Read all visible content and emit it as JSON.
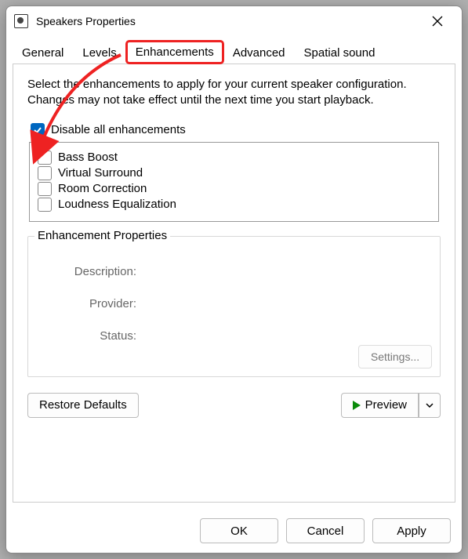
{
  "window": {
    "title": "Speakers Properties"
  },
  "tabs": {
    "general": "General",
    "levels": "Levels",
    "enhancements": "Enhancements",
    "advanced": "Advanced",
    "spatial": "Spatial sound",
    "active": "enhancements"
  },
  "description": "Select the enhancements to apply for your current speaker configuration. Changes may not take effect until the next time you start playback.",
  "disable_all": {
    "label": "Disable all enhancements",
    "checked": true
  },
  "enhancements": [
    {
      "label": "Bass Boost",
      "checked": false
    },
    {
      "label": "Virtual Surround",
      "checked": false
    },
    {
      "label": "Room Correction",
      "checked": false
    },
    {
      "label": "Loudness Equalization",
      "checked": false
    }
  ],
  "properties": {
    "title": "Enhancement Properties",
    "description_label": "Description:",
    "provider_label": "Provider:",
    "status_label": "Status:",
    "settings_button": "Settings..."
  },
  "buttons": {
    "restore": "Restore Defaults",
    "preview": "Preview",
    "ok": "OK",
    "cancel": "Cancel",
    "apply": "Apply"
  }
}
